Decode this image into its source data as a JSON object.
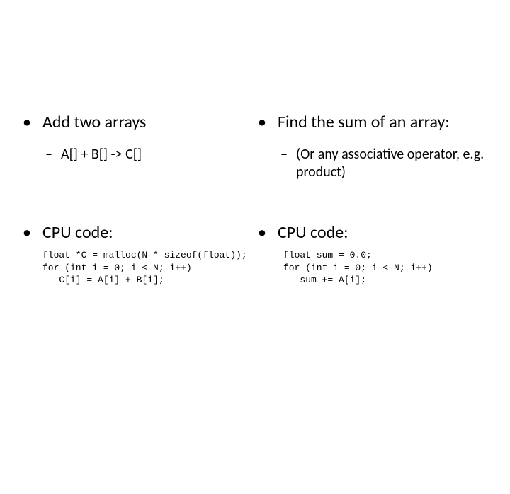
{
  "left": {
    "title": "Add two arrays",
    "sub": "A[] + B[] -> C[]",
    "cpu_label": "CPU code:",
    "code": "float *C = malloc(N * sizeof(float));\nfor (int i = 0; i < N; i++)\n   C[i] = A[i] + B[i];"
  },
  "right": {
    "title": "Find the sum of an array:",
    "sub": "(Or any associative operator, e.g. product)",
    "cpu_label": "CPU code:",
    "code": "float sum = 0.0;\nfor (int i = 0; i < N; i++)\n   sum += A[i];"
  }
}
